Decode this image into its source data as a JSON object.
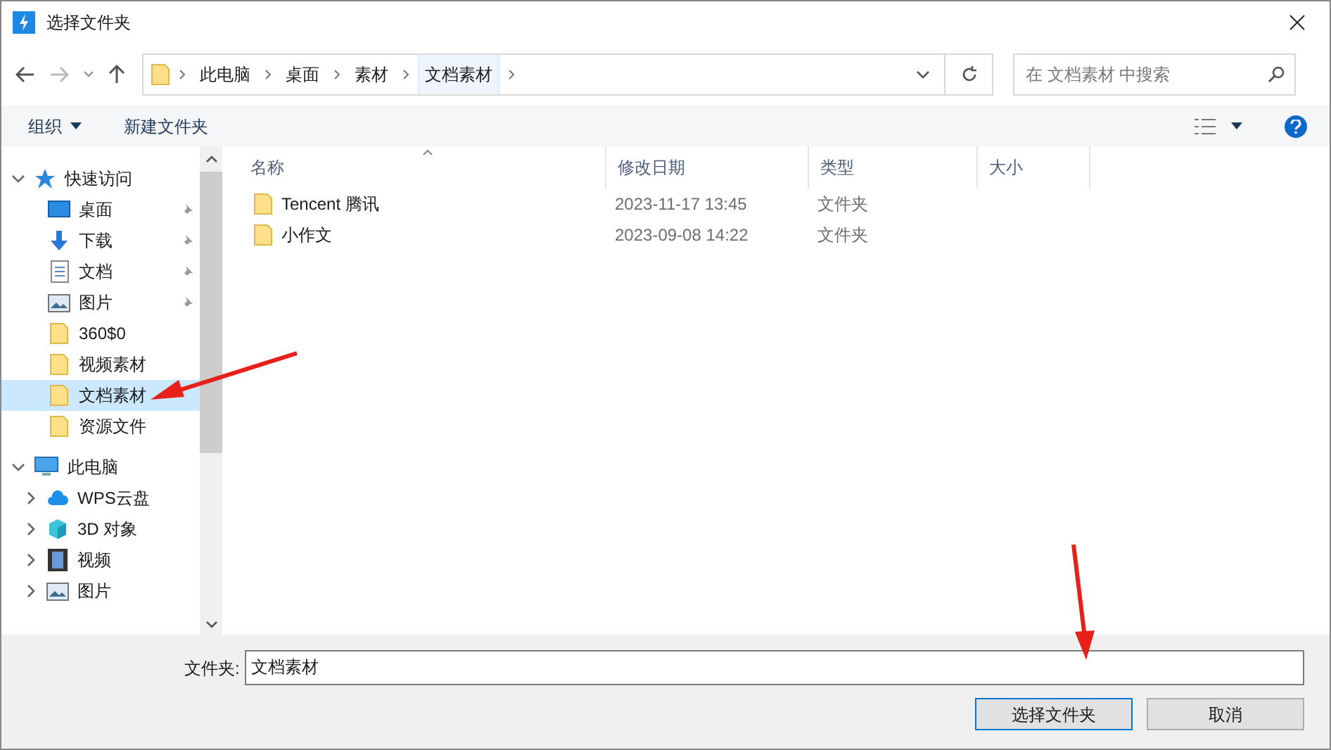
{
  "window": {
    "title": "选择文件夹"
  },
  "breadcrumb": [
    "此电脑",
    "桌面",
    "素材",
    "文档素材"
  ],
  "search": {
    "placeholder": "在 文档素材 中搜索"
  },
  "toolbar": {
    "organize": "组织",
    "new_folder": "新建文件夹"
  },
  "sidebar": {
    "items": [
      {
        "label": "快速访问",
        "kind": "star",
        "expanded": true,
        "selected": false,
        "children": [
          {
            "label": "桌面",
            "kind": "desktop",
            "pinned": true,
            "selected": false
          },
          {
            "label": "下载",
            "kind": "download",
            "pinned": true,
            "selected": false
          },
          {
            "label": "文档",
            "kind": "document",
            "pinned": true,
            "selected": false
          },
          {
            "label": "图片",
            "kind": "image",
            "pinned": true,
            "selected": false
          },
          {
            "label": "360$0",
            "kind": "folder",
            "pinned": false,
            "selected": false
          },
          {
            "label": "视频素材",
            "kind": "folder",
            "pinned": false,
            "selected": false
          },
          {
            "label": "文档素材",
            "kind": "folder",
            "pinned": false,
            "selected": true
          },
          {
            "label": "资源文件",
            "kind": "folder",
            "pinned": false,
            "selected": false
          }
        ]
      },
      {
        "label": "此电脑",
        "kind": "pc",
        "expanded": true,
        "selected": false,
        "children": [
          {
            "label": "WPS云盘",
            "kind": "cloud",
            "selected": false
          },
          {
            "label": "3D 对象",
            "kind": "cube",
            "selected": false
          },
          {
            "label": "视频",
            "kind": "film",
            "selected": false
          },
          {
            "label": "图片",
            "kind": "image",
            "selected": false
          }
        ]
      }
    ]
  },
  "table": {
    "columns": [
      "名称",
      "修改日期",
      "类型",
      "大小"
    ],
    "rows": [
      {
        "name": "Tencent 腾讯",
        "modified": "2023-11-17 13:45",
        "type": "文件夹"
      },
      {
        "name": "小作文",
        "modified": "2023-09-08 14:22",
        "type": "文件夹"
      }
    ]
  },
  "footer": {
    "label": "文件夹:",
    "value": "文档素材",
    "buttons": [
      "选择文件夹",
      "取消"
    ]
  }
}
